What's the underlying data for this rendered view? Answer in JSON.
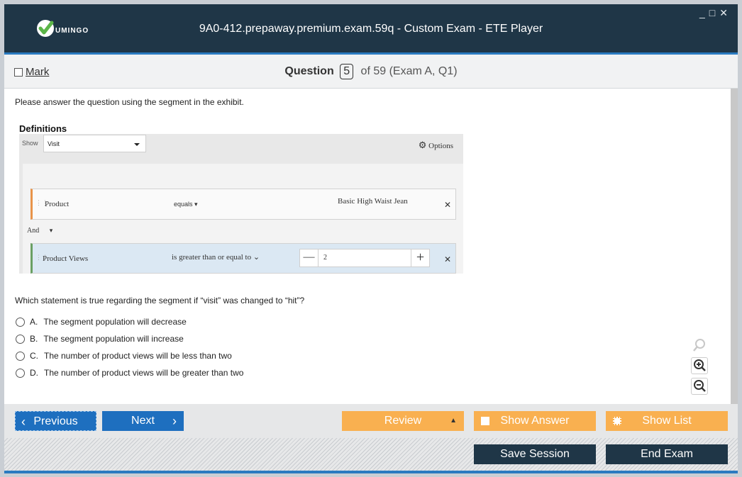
{
  "app": {
    "title": "9A0-412.prepaway.premium.exam.59q - Custom Exam - ETE Player",
    "logo_text": "UMINGO",
    "window_controls": "_ □ ✕"
  },
  "header": {
    "mark_label": "Mark",
    "question_label": "Question",
    "question_number": "5",
    "question_of": "of 59 (Exam A, Q1)"
  },
  "question": {
    "intro": "Please answer the question using the segment in the exhibit.",
    "prompt": "Which statement is true regarding the segment if “visit” was changed to “hit”?"
  },
  "exhibit": {
    "title": "Definitions",
    "show_label": "Show",
    "show_value": "Visit",
    "options_label": "Options",
    "rule1": {
      "dimension": "Product",
      "operator": "equals",
      "value": "Basic High Waist Jean"
    },
    "connector": "And",
    "rule2": {
      "metric": "Product Views",
      "operator": "is greater than or equal to",
      "value": "2"
    }
  },
  "answers": [
    {
      "letter": "A.",
      "text": "The segment population will decrease"
    },
    {
      "letter": "B.",
      "text": "The segment population will increase"
    },
    {
      "letter": "C.",
      "text": "The number of product views will be less than two"
    },
    {
      "letter": "D.",
      "text": "The number of product views will be greater than two"
    }
  ],
  "nav": {
    "previous": "Previous",
    "next": "Next",
    "review": "Review",
    "show_answer": "Show Answer",
    "show_list": "Show List",
    "save_session": "Save Session",
    "end_exam": "End Exam"
  },
  "colors": {
    "titlebar": "#1f3647",
    "accent_blue": "#1e6fbf",
    "orange": "#f9b050",
    "logo_green": "#5bb548"
  }
}
